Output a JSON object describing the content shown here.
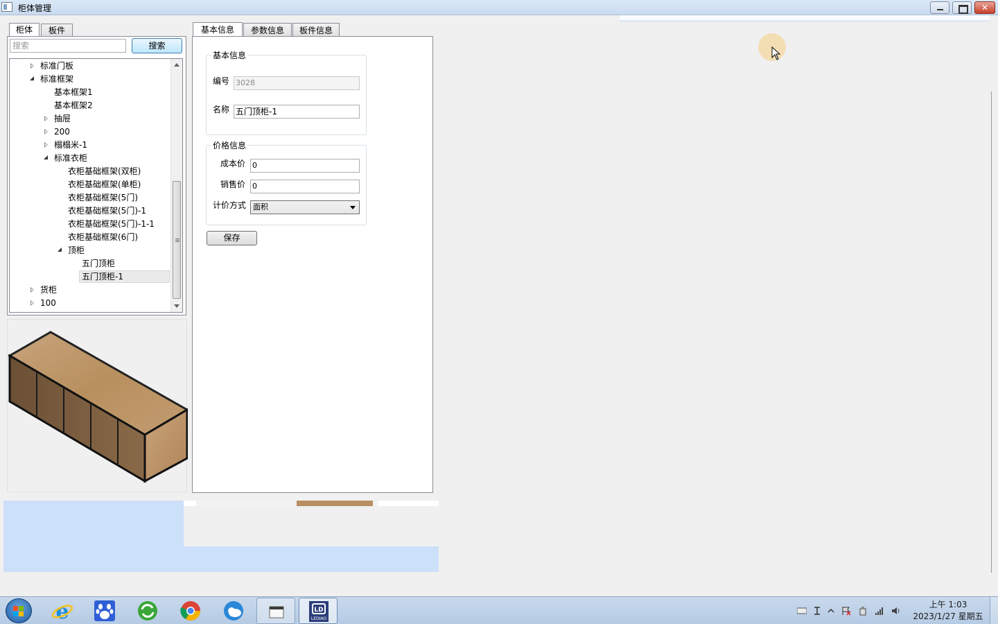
{
  "window": {
    "title": "柜体管理"
  },
  "left_tabs": [
    {
      "label": "柜体"
    },
    {
      "label": "板件"
    }
  ],
  "search": {
    "placeholder": "搜索",
    "button_label": "搜索"
  },
  "tree": {
    "items": [
      {
        "label": "标准门板",
        "depth": 1,
        "state": "collapsed"
      },
      {
        "label": "标准框架",
        "depth": 1,
        "state": "expanded"
      },
      {
        "label": "基本框架1",
        "depth": 2,
        "state": "leaf"
      },
      {
        "label": "基本框架2",
        "depth": 2,
        "state": "leaf"
      },
      {
        "label": "抽屉",
        "depth": 2,
        "state": "collapsed"
      },
      {
        "label": "200",
        "depth": 2,
        "state": "collapsed"
      },
      {
        "label": "榻榻米-1",
        "depth": 2,
        "state": "collapsed"
      },
      {
        "label": "标准衣柜",
        "depth": 2,
        "state": "expanded"
      },
      {
        "label": "衣柜基础框架(双柜)",
        "depth": 3,
        "state": "leaf"
      },
      {
        "label": "衣柜基础框架(单柜)",
        "depth": 3,
        "state": "leaf"
      },
      {
        "label": "衣柜基础框架(5门)",
        "depth": 3,
        "state": "leaf"
      },
      {
        "label": "衣柜基础框架(5门)-1",
        "depth": 3,
        "state": "leaf"
      },
      {
        "label": "衣柜基础框架(5门)-1-1",
        "depth": 3,
        "state": "leaf"
      },
      {
        "label": "衣柜基础框架(6门)",
        "depth": 3,
        "state": "leaf"
      },
      {
        "label": "顶柜",
        "depth": 3,
        "state": "expanded"
      },
      {
        "label": "五门顶柜",
        "depth": 4,
        "state": "leaf"
      },
      {
        "label": "五门顶柜-1",
        "depth": 4,
        "state": "leaf",
        "selected": true
      },
      {
        "label": "货柜",
        "depth": 1,
        "state": "collapsed"
      },
      {
        "label": "100",
        "depth": 1,
        "state": "collapsed"
      }
    ]
  },
  "right_tabs": [
    {
      "label": "基本信息"
    },
    {
      "label": "参数信息"
    },
    {
      "label": "板件信息"
    }
  ],
  "basic_info": {
    "group_title": "基本信息",
    "code_label": "编号",
    "code_value": "3028",
    "name_label": "名称",
    "name_value": "五门顶柜-1"
  },
  "price_info": {
    "group_title": "价格信息",
    "cost_label": "成本价",
    "cost_value": "0",
    "sale_label": "销售价",
    "sale_value": "0",
    "pricing_label": "计价方式",
    "pricing_value": "面积"
  },
  "save_button_label": "保存",
  "taskbar": {
    "apps": [
      {
        "name": "internet-explorer"
      },
      {
        "name": "baidu"
      },
      {
        "name": "refresh-app"
      },
      {
        "name": "chrome"
      },
      {
        "name": "cloud-app"
      },
      {
        "name": "file-explorer"
      },
      {
        "name": "lediao",
        "label": "LEDIAO"
      }
    ],
    "time": "上午 1:03",
    "date": "2023/1/27 星期五"
  },
  "colors": {
    "accent": "#3c7fb1",
    "taskbar": "#b5cbe4",
    "selection": "#cde0fa"
  }
}
